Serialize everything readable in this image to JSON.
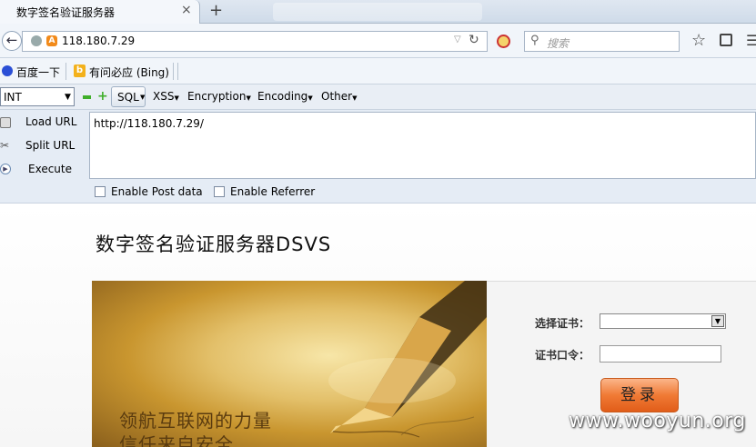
{
  "browser": {
    "tab_title": "数字签名验证服务器",
    "tab_close": "×",
    "new_tab": "+",
    "url": "118.180.7.29",
    "search_placeholder": "搜索"
  },
  "bookmarks": [
    {
      "label": "百度一下"
    },
    {
      "label": "有问必应 (Bing)"
    }
  ],
  "hackbar": {
    "type_select": "INT",
    "menus": {
      "sql": "SQL",
      "xss": "XSS",
      "encryption": "Encryption",
      "encoding": "Encoding",
      "other": "Other"
    },
    "load_url": "Load URL",
    "split_url": "Split URL",
    "execute": "Execute",
    "url_value": "http://118.180.7.29/",
    "enable_post": "Enable Post data",
    "enable_referrer": "Enable Referrer"
  },
  "page": {
    "title": "数字签名验证服务器DSVS",
    "slogan_line1": "领航互联网的力量",
    "slogan_line2": "信任来自安全",
    "cert_label": "选择证书：",
    "pin_label": "证书口令：",
    "login_button": "登录"
  },
  "watermark": "www.wooyun.org",
  "colors": {
    "accent_orange": "#f07a35",
    "chrome_bg": "#f1f5fa"
  }
}
